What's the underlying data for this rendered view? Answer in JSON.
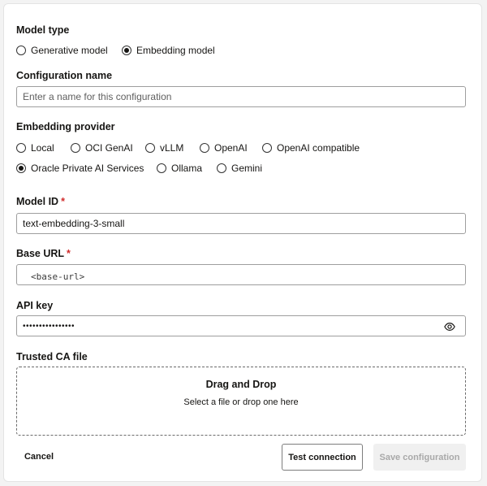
{
  "model_type": {
    "label": "Model type",
    "options": [
      {
        "label": "Generative model",
        "checked": false
      },
      {
        "label": "Embedding model",
        "checked": true
      }
    ]
  },
  "config_name": {
    "label": "Configuration name",
    "placeholder": "Enter a name for this configuration"
  },
  "embedding_provider": {
    "label": "Embedding provider",
    "options": [
      {
        "label": "Local",
        "checked": false
      },
      {
        "label": "OCI GenAI",
        "checked": false
      },
      {
        "label": "vLLM",
        "checked": false
      },
      {
        "label": "OpenAI",
        "checked": false
      },
      {
        "label": "OpenAI compatible",
        "checked": false
      },
      {
        "label": "Oracle Private AI Services",
        "checked": true
      },
      {
        "label": "Ollama",
        "checked": false
      },
      {
        "label": "Gemini",
        "checked": false
      }
    ]
  },
  "model_id": {
    "label": "Model ID",
    "required_mark": "*",
    "value": "text-embedding-3-small"
  },
  "base_url": {
    "label": "Base URL",
    "required_mark": "*",
    "value": "<base-url>"
  },
  "api_key": {
    "label": "API key",
    "value": "••••••••••••••••",
    "toggle_icon": "eye-icon"
  },
  "trusted_ca": {
    "label": "Trusted CA file",
    "drop_title": "Drag and Drop",
    "drop_subtitle": "Select a file or drop one here"
  },
  "actions": {
    "cancel": "Cancel",
    "test": "Test connection",
    "save": "Save configuration"
  },
  "colors": {
    "required": "#d02b2b",
    "disabled_bg": "#f0f0f0",
    "disabled_text": "#a9a9a9"
  }
}
